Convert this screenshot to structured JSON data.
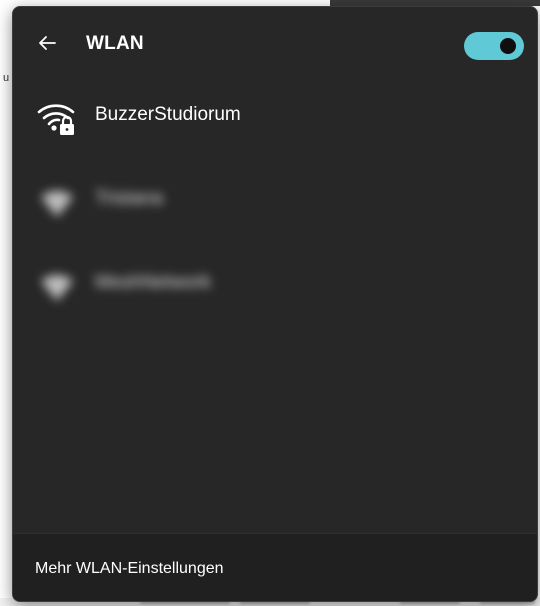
{
  "wifi_panel": {
    "title": "WLAN",
    "back_icon": "arrow-left-icon",
    "toggle_on": true,
    "accent_color": "#5fc9d6",
    "networks": [
      {
        "name": "BuzzerStudiorum",
        "icon": "wifi-secured-icon",
        "blurred": false
      },
      {
        "name": "Tristana",
        "icon": "wifi-icon",
        "blurred": true
      },
      {
        "name": "MeshNetwork",
        "icon": "wifi-icon",
        "blurred": true
      }
    ],
    "more_settings_label": "Mehr WLAN-Einstellungen"
  }
}
